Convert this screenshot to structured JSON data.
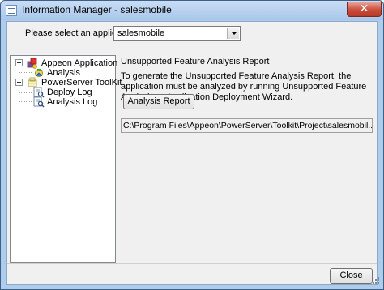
{
  "window": {
    "title": "Information Manager - salesmobile",
    "close_glyph": "✕"
  },
  "selector": {
    "label": "Please select an application:",
    "value": "salesmobile"
  },
  "tree": {
    "items": [
      {
        "label": "Appeon Application",
        "icon": "appeon-app-icon"
      },
      {
        "label": "Analysis",
        "icon": "analysis-icon"
      },
      {
        "label": "PowerServer ToolKit",
        "icon": "toolkit-icon"
      },
      {
        "label": "Deploy Log",
        "icon": "log-icon"
      },
      {
        "label": "Analysis Log",
        "icon": "log-icon"
      }
    ]
  },
  "panel": {
    "group_title": "Unsupported Feature Analysis Report",
    "description": "To generate the Unsupported Feature Analysis Report, the application must be analyzed by running Unsupported Feature Analysis or Application Deployment Wizard.",
    "report_button": "Analysis Report",
    "report_path": "C:\\Program Files\\Appeon\\PowerServer\\Toolkit\\Project\\salesmobil...\\UFA_Report.xml"
  },
  "footer": {
    "close_button": "Close"
  },
  "colors": {
    "window_frame": "#aeccec",
    "client_bg": "#f0f0f0",
    "close_button_red": "#c94c3a"
  }
}
